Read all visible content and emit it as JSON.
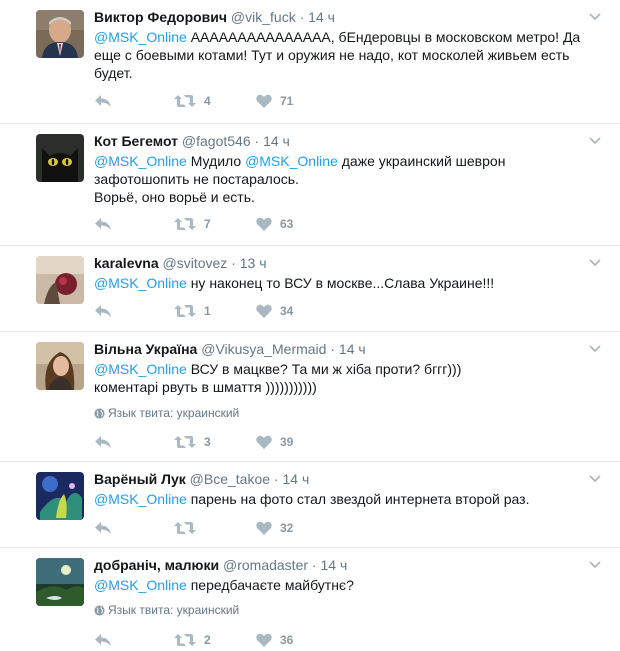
{
  "tweets": [
    {
      "name": "Виктор Федорович",
      "handle": "@vik_fuck",
      "time": "14 ч",
      "mention": "@MSK_Online",
      "text_after_mention": " ААААААААААААААА, бЕндеровцы в московском метро! Да еще с боевыми котами! Тут и оружия не надо, кот москолей живьем есть будет.",
      "mention2": "",
      "text_after_mention2": "",
      "line3": "",
      "lang": "",
      "retweets": "4",
      "likes": "71",
      "avatar": "man-portrait-avatar"
    },
    {
      "name": "Кот Бегемот",
      "handle": "@fagot546",
      "time": "14 ч",
      "mention": "@MSK_Online",
      "text_after_mention": " Мудило ",
      "mention2": "@MSK_Online",
      "text_after_mention2": "  даже украинский шеврон зафотошопить не постаралось.",
      "line3": "Ворьё, оно ворьё и есть.",
      "lang": "",
      "retweets": "7",
      "likes": "63",
      "avatar": "black-cat-avatar"
    },
    {
      "name": "karalevna",
      "handle": "@svitovez",
      "time": "13 ч",
      "mention": "@MSK_Online",
      "text_after_mention": " ну наконец то ВСУ в москве...Слава Украине!!!",
      "mention2": "",
      "text_after_mention2": "",
      "line3": "",
      "lang": "",
      "retweets": "1",
      "likes": "34",
      "avatar": "flower-photo-avatar"
    },
    {
      "name": "Вільна Україна",
      "handle": "@Vikusya_Mermaid",
      "time": "14 ч",
      "mention": "@MSK_Online",
      "text_after_mention": " ВСУ в мацкве? Та ми ж хіба проти? бггг)))",
      "mention2": "",
      "text_after_mention2": "",
      "line3": "коментарі рвуть в шмаття )))))))))))",
      "lang": "Язык твита: украинский",
      "retweets": "3",
      "likes": "39",
      "avatar": "woman-portrait-avatar"
    },
    {
      "name": "Варёный Лук",
      "handle": "@Все_takoe",
      "time": "14 ч",
      "mention": "@MSK_Online",
      "text_after_mention": " парень на фото стал звездой интернета второй раз.",
      "mention2": "",
      "text_after_mention2": "",
      "line3": "",
      "lang": "",
      "retweets": "",
      "likes": "32",
      "avatar": "fantasy-art-avatar"
    },
    {
      "name": "добраніч, малюки",
      "handle": "@romadaster",
      "time": "14 ч",
      "mention": "@MSK_Online",
      "text_after_mention": " передбачаєте майбутнє?",
      "mention2": "",
      "text_after_mention2": "",
      "line3": "",
      "lang": "Язык твита: украинский",
      "retweets": "2",
      "likes": "36",
      "avatar": "night-landscape-avatar"
    }
  ],
  "colors": {
    "mention": "#1da1f2",
    "meta": "#657786",
    "action_icon": "#aab8c2",
    "divider": "#e6ecf0"
  },
  "icons": {
    "reply": "reply-icon",
    "retweet": "retweet-icon",
    "like": "heart-icon",
    "more": "chevron-down-icon",
    "globe": "globe-icon"
  }
}
